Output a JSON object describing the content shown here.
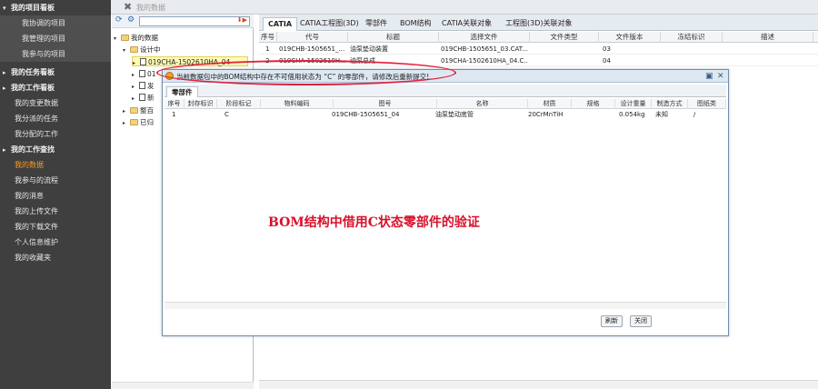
{
  "sidebar": {
    "sections": [
      {
        "label": "我的项目看板",
        "items": [
          "我协调的项目",
          "我管理的项目",
          "我参与的项目"
        ]
      },
      {
        "label": "我的任务看板"
      },
      {
        "label": "我的工作看板"
      }
    ],
    "items": [
      "我的变更数据",
      "我分派的任务",
      "我分配的工作"
    ],
    "work_query": "我的工作查找",
    "data_items": [
      "我的数据",
      "我参与的流程",
      "我的消息",
      "我的上传文件",
      "我的下载文件",
      "个人信息维护",
      "我的收藏夹"
    ]
  },
  "topbar": {
    "title": "我的数据"
  },
  "tree": {
    "root": "我的数据",
    "designing": "设计中",
    "selected_node": "019CHA-1502610HA_04",
    "nodes": [
      "01",
      "发",
      "新"
    ],
    "folder1": "整百",
    "folder2": "已归"
  },
  "tabs": [
    "CATIA",
    "CATIA工程图(3D)",
    "零部件",
    "BOM结构",
    "CATIA关联对象",
    "工程图(3D)关联对象"
  ],
  "grid": {
    "columns": [
      "序号",
      "代号",
      "标题",
      "选择文件",
      "文件类型",
      "文件版本",
      "冻结标识",
      "描述"
    ],
    "rows": [
      [
        "1",
        "019CHB-1505651_...",
        "油泵垫动装置",
        "019CHB-1505651_03.CAT...",
        "",
        "03",
        "",
        ""
      ],
      [
        "2",
        "019CHA-1502610H...",
        "油泵总成",
        "019CHA-1502610HA_04.C...",
        "",
        "04",
        "",
        ""
      ]
    ]
  },
  "dialog": {
    "title": "当前数据包中的BOM结构中存在不可借用状态为 “C” 的零部件，请修改后重新提交!",
    "tab": "零部件",
    "columns": [
      "序号",
      "封存标识",
      "阶段标记",
      "物料编码",
      "图号",
      "名称",
      "材质",
      "规格",
      "设计重量",
      "制造方式",
      "图纸类"
    ],
    "row": [
      "1",
      "",
      "C",
      "",
      "019CHB-1505651_04",
      "油泵垫动底管",
      "20CrMnTiH",
      "",
      "0.054kg",
      "未知",
      "/"
    ],
    "annotation": "BOM结构中借用C状态零部件的验证",
    "refresh_label": "刷新",
    "close_label": "关闭"
  },
  "colors": {
    "sidebar_bg": "#3f3f3f",
    "active_nav": "#ff9a1a",
    "annotation": "#d8102a",
    "highlight_oval": "#e0203a"
  }
}
